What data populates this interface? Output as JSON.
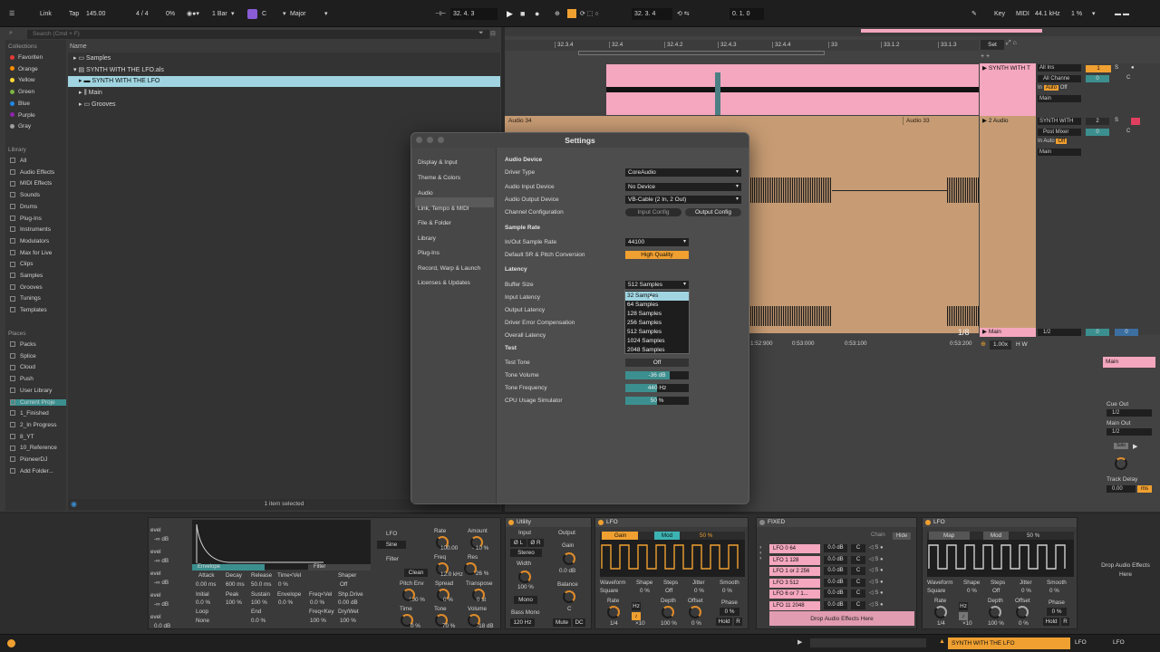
{
  "transport": {
    "link": "Link",
    "tap": "Tap",
    "tempo": "145.00",
    "signature": "4 / 4",
    "cpu": "0%",
    "quant": "1 Bar",
    "key_root": "C",
    "scale": "Major",
    "position": "32.  4.  3",
    "loop_start": "32.  3.  4",
    "loop_len": "0.  1.  0",
    "key_label": "Key",
    "midi_label": "MIDI",
    "sample_rate": "44.1 kHz",
    "cpu_load": "1 %"
  },
  "browser": {
    "search_placeholder": "Search (Cmd + F)",
    "collections_heading": "Collections",
    "collections": [
      {
        "label": "Favoriten",
        "color": "#e53935"
      },
      {
        "label": "Orange",
        "color": "#fb8c00"
      },
      {
        "label": "Yellow",
        "color": "#fdd835"
      },
      {
        "label": "Green",
        "color": "#7cb342"
      },
      {
        "label": "Blue",
        "color": "#1e88e5"
      },
      {
        "label": "Purple",
        "color": "#8e24aa"
      },
      {
        "label": "Gray",
        "color": "#9e9e9e"
      }
    ],
    "library_heading": "Library",
    "library": [
      "All",
      "Audio Effects",
      "MIDI Effects",
      "Sounds",
      "Drums",
      "Plug-Ins",
      "Instruments",
      "Modulators",
      "Max for Live",
      "Clips",
      "Samples",
      "Grooves",
      "Tunings",
      "Templates"
    ],
    "places_heading": "Places",
    "places": [
      "Packs",
      "Splice",
      "Cloud",
      "Push",
      "User Library",
      "Current Proje",
      "1_Finished",
      "2_In Progress",
      "8_YT",
      "10_Reference",
      "PioneerDJ",
      "Add Folder..."
    ],
    "name_col": "Name",
    "files": [
      "Samples",
      "SYNTH WITH THE LFO.als",
      "SYNTH WITH THE LFO",
      "Main",
      "Grooves"
    ],
    "status": "1 item selected"
  },
  "arrangement": {
    "ruler": [
      "32.3.4",
      "32.4",
      "32.4.2",
      "32.4.3",
      "32.4.4",
      "33",
      "33.1.2",
      "33.1.3"
    ],
    "set_label": "Set",
    "tracks": [
      {
        "name": "SYNTH WITH T",
        "input": "All Ins",
        "channel": "All Channe",
        "monitor": [
          "In",
          "Auto",
          "Off"
        ],
        "out": "Main",
        "num": "1"
      },
      {
        "name": "2 Audio",
        "input": "SYNTH WITH",
        "channel": "Post Mixer",
        "monitor": [
          "In",
          "Auto",
          "Off"
        ],
        "out": "Main",
        "num": "2"
      }
    ],
    "clip1": "Audio 34",
    "clip2": "Audio 33",
    "time_ticks": [
      "1:52:900",
      "0:53:000",
      "0:53:100",
      "0:53:200"
    ],
    "fraction": "1/8",
    "zoom": "1.00x",
    "main_track": "Main",
    "main_track_sel": "1/2",
    "mix_zero": "0",
    "right": {
      "main": "Main",
      "cue_out": "Cue Out",
      "cue_sel": "1/2",
      "main_out": "Main Out",
      "main_sel": "1/2",
      "solo": "Solo",
      "track_delay": "Track Delay",
      "delay_val": "0.00",
      "delay_unit": "ms"
    }
  },
  "settings": {
    "title": "Settings",
    "nav": [
      "Display & Input",
      "Theme & Colors",
      "Audio",
      "Link, Tempo & MIDI",
      "File & Folder",
      "Library",
      "Plug-Ins",
      "Record, Warp & Launch",
      "Licenses & Updates"
    ],
    "audio_device": "Audio Device",
    "driver_type_label": "Driver Type",
    "driver_type": "CoreAudio",
    "input_device_label": "Audio Input Device",
    "input_device": "No Device",
    "output_device_label": "Audio Output Device",
    "output_device": "VB-Cable (2 In, 2 Out)",
    "channel_config_label": "Channel Configuration",
    "input_config": "Input Config",
    "output_config": "Output Config",
    "sample_rate_heading": "Sample Rate",
    "sr_label": "In/Out Sample Rate",
    "sr_value": "44100",
    "conv_label": "Default SR & Pitch Conversion",
    "conv_value": "High Quality",
    "latency_heading": "Latency",
    "buffer_label": "Buffer Size",
    "buffer_value": "512 Samples",
    "input_latency": "Input Latency",
    "output_latency": "Output Latency",
    "driver_error": "Driver Error Compensation",
    "overall_latency": "Overall Latency",
    "buffer_options": [
      "32 Samples",
      "64 Samples",
      "128 Samples",
      "256 Samples",
      "512 Samples",
      "1024 Samples",
      "2048 Samples"
    ],
    "test_heading": "Test",
    "test_tone_label": "Test Tone",
    "test_tone": "Off",
    "tone_volume_label": "Tone Volume",
    "tone_volume": "-36 dB",
    "tone_volume_level": 0.7,
    "tone_freq_label": "Tone Frequency",
    "tone_freq": "440 Hz",
    "tone_freq_level": 0.5,
    "cpu_sim_label": "CPU Usage Simulator",
    "cpu_sim": "50 %",
    "cpu_sim_level": 0.5
  },
  "devices": {
    "sampler": {
      "labels": [
        "evel",
        "evel",
        "evel",
        "evel",
        "evel"
      ],
      "vals": [
        "-∞ dB",
        "-∞ dB",
        "-∞ dB",
        "-∞ dB",
        "0.0 dB"
      ],
      "envelope": "Envelope",
      "filter": "Filter",
      "attack": "Attack",
      "decay": "Decay",
      "release": "Release",
      "time_vel": "Time<Vel",
      "shaper": "Shaper",
      "attack_v": "0.00 ms",
      "decay_v": "600 ms",
      "release_v": "50.0 ms",
      "time_vel_v": "0 %",
      "shaper_v": "Off",
      "initial": "Initial",
      "peak": "Peak",
      "sustain": "Sustain",
      "envelope2": "Envelope",
      "freq_vel": "Freq<Vel",
      "shp_drive": "Shp.Drive",
      "initial_v": "0.0 %",
      "peak_v": "100 %",
      "sustain_v": "100 %",
      "envelope_v": "0.0 %",
      "freq_vel_v": "0.0 %",
      "shp_drive_v": "0.00 dB",
      "loop": "Loop",
      "end": "End",
      "freq_key": "Freq<Key",
      "dry_wet": "Dry/Wet",
      "loop_v": "None",
      "end_v": "0.0 %",
      "freq_key_v": "100 %",
      "dry_wet_v": "100 %",
      "lfo": "LFO",
      "lfo_wave": "Sine",
      "rate": "Rate",
      "rate_v": "100.00",
      "amount": "Amount",
      "amount_v": "- 10 %",
      "filter_l": "Filter",
      "filter_mode": "Clean",
      "freq": "Freq",
      "freq_v": "12.0 kHz",
      "res": "Res",
      "res_v": "26 %",
      "filter_pct": "100 %",
      "pitch_env": "Pitch Env",
      "pitch_env_v": "0 %",
      "spread": "Spread",
      "spread_v": "0 %",
      "transpose": "Transpose",
      "transpose_v": "0 st",
      "time": "Time",
      "time_v": "0 %",
      "tone": "Tone",
      "tone_v": "70 %",
      "volume": "Volume",
      "volume_v": "-18 dB"
    },
    "utility": {
      "title": "Utility",
      "input": "Input",
      "output": "Output",
      "phase_l": "Ø L",
      "phase_r": "Ø R",
      "stereo": "Stereo",
      "gain": "Gain",
      "gain_v": "0.0 dB",
      "width": "Width",
      "width_v": "100 %",
      "mono": "Mono",
      "balance": "Balance",
      "balance_v": "C",
      "bass_mono": "Bass Mono",
      "bass_v": "120 Hz",
      "mute": "Mute",
      "dc": "DC"
    },
    "lfo1": {
      "title": "LFO",
      "gain": "Gain",
      "mod": "Mod",
      "pct": "50 %",
      "waveform": "Waveform",
      "shape": "Shape",
      "steps": "Steps",
      "jitter": "Jitter",
      "smooth": "Smooth",
      "waveform_v": "Square",
      "shape_v": "0 %",
      "steps_v": "Off",
      "jitter_v": "0 %",
      "smooth_v": "0 %",
      "rate": "Rate",
      "depth": "Depth",
      "offset": "Offset",
      "phase": "Phase",
      "rate_v": "1/4",
      "hz": "Hz",
      "x10": "×10",
      "depth_v": "100 %",
      "offset_v": "0 %",
      "phase_v": "0 %",
      "hold": "Hold",
      "r": "R"
    },
    "fixed": {
      "title": "FIXED",
      "chain": "Chain",
      "hide": "Hide",
      "chains": [
        {
          "name": "LFO 0 64",
          "vol": "0.0 dB"
        },
        {
          "name": "LFO 1 128",
          "vol": "0.0 dB"
        },
        {
          "name": "LFO 1 or 2 256",
          "vol": "0.0 dB"
        },
        {
          "name": "LFO 3 512",
          "vol": "0.0 dB"
        },
        {
          "name": "LFO 6 or 7 1...",
          "vol": "0.0 dB"
        },
        {
          "name": "LFO 11 2048",
          "vol": "0.0 dB"
        }
      ],
      "pan": "C",
      "drop": "Drop Audio Effects Here"
    },
    "lfo2": {
      "title": "LFO",
      "map": "Map",
      "mod": "Mod",
      "pct": "50 %",
      "waveform": "Waveform",
      "shape": "Shape",
      "steps": "Steps",
      "jitter": "Jitter",
      "smooth": "Smooth",
      "waveform_v": "Square",
      "shape_v": "0 %",
      "steps_v": "Off",
      "jitter_v": "0 %",
      "smooth_v": "0 %",
      "rate": "Rate",
      "depth": "Depth",
      "offset": "Offset",
      "phase": "Phase",
      "rate_v": "1/4",
      "hz": "Hz",
      "x10": "×10",
      "depth_v": "100 %",
      "offset_v": "0 %",
      "phase_v": "0 %",
      "hold": "Hold",
      "r": "R"
    },
    "drop_right": "Drop Audio Effects Here"
  },
  "statusbar": {
    "track": "SYNTH WITH THE LFO",
    "lfo1": "LFO",
    "lfo2": "LFO"
  },
  "colors": {
    "accent": "#f0a030",
    "pink": "#f4a7bf",
    "clip_orange": "#c79c74",
    "teal": "#3c8f8f",
    "selection": "#7cc6d6"
  }
}
